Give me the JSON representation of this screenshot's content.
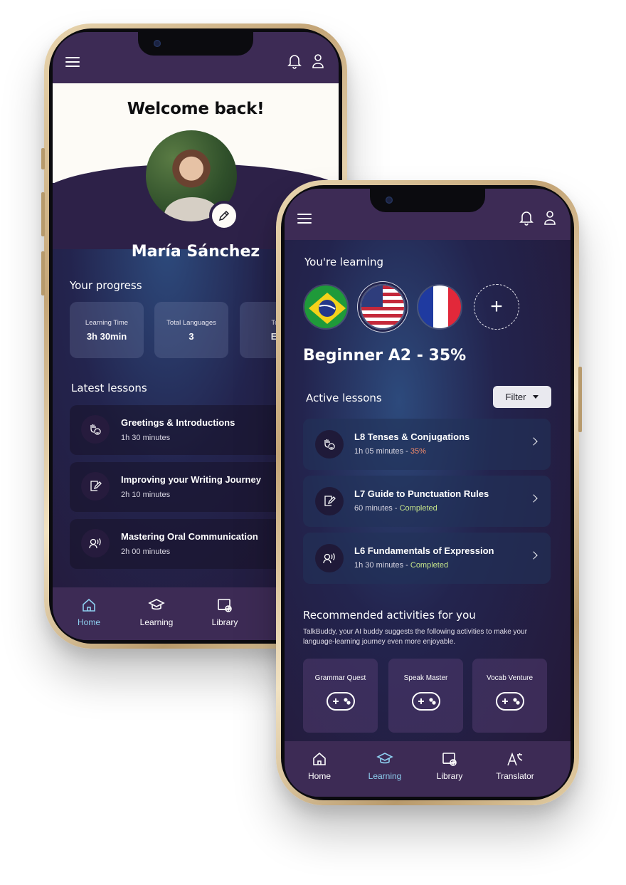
{
  "home_screen": {
    "welcome_title": "Welcome back!",
    "user_name": "María Sánchez",
    "progress_heading": "Your progress",
    "stats": [
      {
        "label": "Learning Time",
        "value": "3h 30min"
      },
      {
        "label": "Total Languages",
        "value": "3"
      },
      {
        "label": "Top",
        "value": "En"
      }
    ],
    "latest_heading": "Latest lessons",
    "lessons": [
      {
        "title": "Greetings & Introductions",
        "duration": "1h 30 minutes",
        "icon": "greeting-hand-icon"
      },
      {
        "title": "Improving your Writing Journey",
        "duration": "2h 10 minutes",
        "icon": "writing-icon"
      },
      {
        "title": "Mastering Oral Communication",
        "duration": "2h 00 minutes",
        "icon": "speaking-icon"
      }
    ],
    "nav": [
      {
        "label": "Home",
        "icon": "home-icon",
        "active": true
      },
      {
        "label": "Learning",
        "icon": "graduation-cap-icon",
        "active": false
      },
      {
        "label": "Library",
        "icon": "library-icon",
        "active": false
      }
    ]
  },
  "learning_screen": {
    "learning_label": "You're learning",
    "flags": [
      "brazil-flag",
      "usa-flag",
      "france-flag"
    ],
    "add_language_symbol": "+",
    "level": "Beginner A2 - 35%",
    "active_heading": "Active lessons",
    "filter_label": "Filter",
    "active_lessons": [
      {
        "title": "L8 Tenses & Conjugations",
        "duration": "1h 05 minutes - ",
        "status": "35%",
        "status_color": "#f08a6a",
        "icon": "greeting-hand-icon"
      },
      {
        "title": "L7 Guide to Punctuation Rules",
        "duration": "60 minutes - ",
        "status": "Completed",
        "status_color": "#c6e58a",
        "icon": "writing-icon"
      },
      {
        "title": "L6 Fundamentals of Expression",
        "duration": "1h 30 minutes - ",
        "status": "Completed",
        "status_color": "#c6e58a",
        "icon": "speaking-icon"
      }
    ],
    "recommended_heading": "Recommended activities for you",
    "recommended_desc": "TalkBuddy, your AI buddy suggests the following activities to make your language-learning journey even more enjoyable.",
    "activities": [
      "Grammar Quest",
      "Speak Master",
      "Vocab Venture"
    ],
    "nav": [
      {
        "label": "Home",
        "icon": "home-icon",
        "active": false
      },
      {
        "label": "Learning",
        "icon": "graduation-cap-icon",
        "active": true
      },
      {
        "label": "Library",
        "icon": "library-icon",
        "active": false
      },
      {
        "label": "Translator",
        "icon": "translator-icon",
        "active": false
      }
    ]
  },
  "colors": {
    "topbar": "#3d2b55",
    "active_nav": "#8ed0f0",
    "progress_status": "#f08a6a",
    "completed_status": "#c6e58a"
  }
}
